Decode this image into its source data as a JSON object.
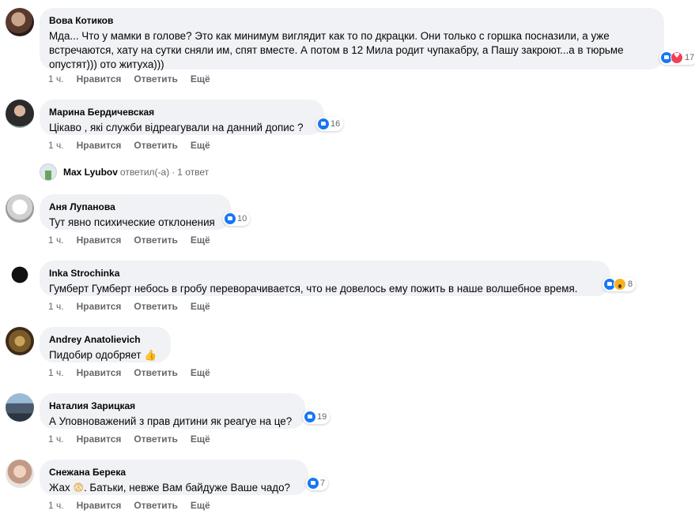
{
  "comments": [
    {
      "author": "Вова Котиков",
      "text": "Мда... Что у мамки в голове? Это как минимум виглядит как то по дкрацки. Они только с горшка посназили, а уже встречаются, хату на сутки сняли им, спят вместе. А потом в 12 Мила родит чупакабру, а Пашу закроют...а в тюрьме опустят))) ото житуха)))",
      "reactions": "17",
      "time": "1 ч.",
      "like": "Нравится",
      "reply": "Ответить",
      "more": "Ещё"
    },
    {
      "author": "Марина Бердичевская",
      "text": "Цікаво , які служби відреагували на данний допис ?",
      "reactions": "16",
      "time": "1 ч.",
      "like": "Нравится",
      "reply": "Ответить",
      "more": "Ещё"
    },
    {
      "author": "Аня Лупанова",
      "text": "Тут явно психические отклонения",
      "reactions": "10",
      "time": "1 ч.",
      "like": "Нравится",
      "reply": "Ответить",
      "more": "Ещё"
    },
    {
      "author": "Inka Strochinka",
      "text": "Гумберт Гумберт небось в гробу переворачивается, что не довелось ему пожить в наше волшебное время.",
      "reactions": "8",
      "time": "1 ч.",
      "like": "Нравится",
      "reply": "Ответить",
      "more": "Ещё"
    },
    {
      "author": "Andrey Anatolievich",
      "text": "Пидобир одобряет",
      "emoji": "👍",
      "time": "1 ч.",
      "like": "Нравится",
      "reply": "Ответить",
      "more": "Ещё"
    },
    {
      "author": "Наталия Зарицкая",
      "text": "А Уповноважений з прав дитини як реагуе на це?",
      "reactions": "19",
      "time": "1 ч.",
      "like": "Нравится",
      "reply": "Ответить",
      "more": "Ещё"
    },
    {
      "author": "Снежана Берека",
      "text_a": "Жах",
      "emoji": "😨",
      "text_b": ". Батьки, невже Вам байдуже Ваше чадо?",
      "reactions": "7",
      "time": "1 ч.",
      "like": "Нравится",
      "reply": "Ответить",
      "more": "Ещё"
    }
  ],
  "reply_summary": {
    "name": "Max Lyubov",
    "verb": "ответил(-а)",
    "count": "1 ответ"
  },
  "colors": {
    "bubble": "#f0f2f5",
    "meta": "#65676b",
    "like": "#1877f2",
    "love": "#f33e58"
  }
}
